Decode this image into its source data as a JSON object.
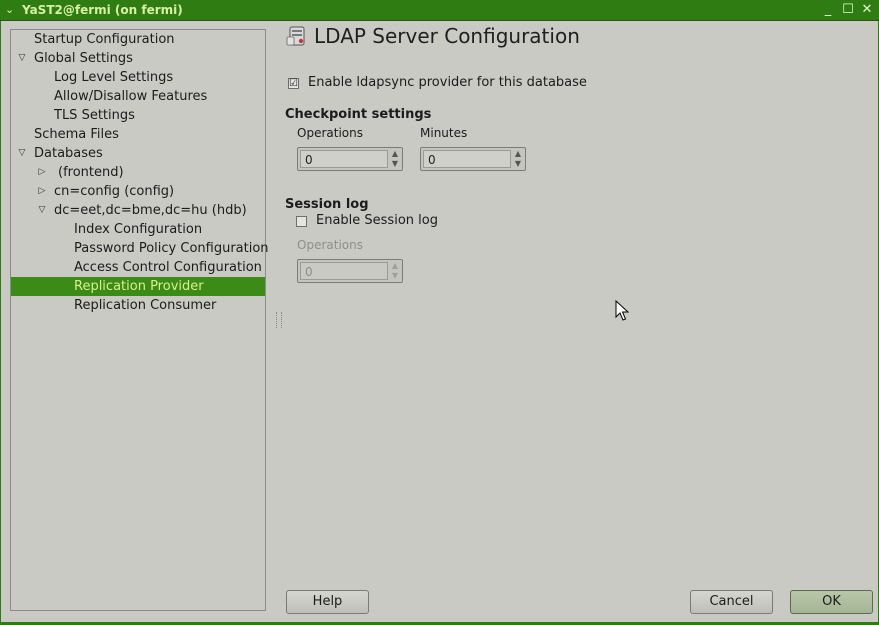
{
  "window": {
    "title": "YaST2@fermi (on fermi)"
  },
  "tree": {
    "items": [
      {
        "label": "Startup Configuration",
        "expander": ""
      },
      {
        "label": "Global Settings",
        "expander": "▽"
      },
      {
        "label": "Log Level Settings",
        "expander": ""
      },
      {
        "label": "Allow/Disallow Features",
        "expander": ""
      },
      {
        "label": "TLS Settings",
        "expander": ""
      },
      {
        "label": "Schema Files",
        "expander": ""
      },
      {
        "label": "Databases",
        "expander": "▽"
      },
      {
        "label": "(frontend)",
        "expander": "▷"
      },
      {
        "label": "cn=config (config)",
        "expander": "▷"
      },
      {
        "label": "dc=eet,dc=bme,dc=hu (hdb)",
        "expander": "▽"
      },
      {
        "label": "Index Configuration",
        "expander": ""
      },
      {
        "label": "Password Policy Configuration",
        "expander": ""
      },
      {
        "label": "Access Control Configuration",
        "expander": ""
      },
      {
        "label": "Replication Provider",
        "expander": ""
      },
      {
        "label": "Replication Consumer",
        "expander": ""
      }
    ]
  },
  "main": {
    "title": "LDAP Server Configuration",
    "enable_provider": {
      "label": "Enable ldapsync provider for this database",
      "checked": "☑"
    },
    "checkpoint": {
      "title": "Checkpoint settings",
      "operations_label": "Operations",
      "operations_value": "0",
      "minutes_label": "Minutes",
      "minutes_value": "0"
    },
    "session_log": {
      "title": "Session log",
      "enable_label": "Enable Session log",
      "operations_label": "Operations",
      "operations_value": "0"
    }
  },
  "buttons": {
    "help": "Help",
    "cancel": "Cancel",
    "ok": "OK"
  },
  "colors": {
    "titlebar": "#2f7d12",
    "selection": "#3d8b17",
    "selection_text": "#d7f08c",
    "background": "#c9cac4"
  }
}
